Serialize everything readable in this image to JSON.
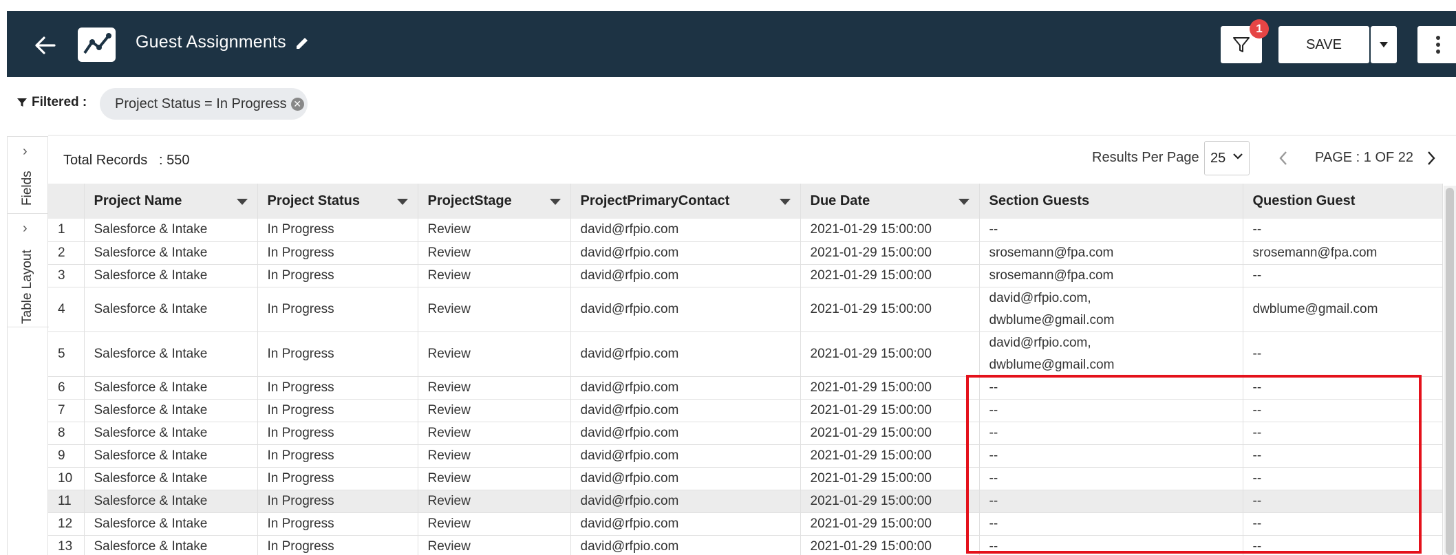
{
  "header": {
    "title": "Guest Assignments",
    "filter_badge": "1",
    "save_label": "SAVE"
  },
  "filter_bar": {
    "label": "Filtered :",
    "chip": "Project Status  = In Progress"
  },
  "side_panel": {
    "tabs": [
      "Fields",
      "Table Layout"
    ]
  },
  "grid_toolbar": {
    "total_records_label": "Total Records",
    "total_records_value": ": 550",
    "results_per_page_label": "Results Per Page",
    "results_per_page_value": "25",
    "page_info": "PAGE : 1 OF 22"
  },
  "table": {
    "columns": [
      "Project Name",
      "Project Status",
      "ProjectStage",
      "ProjectPrimaryContact",
      "Due Date",
      "Section Guests",
      "Question Guest"
    ],
    "rows": [
      {
        "n": "1",
        "name": "Salesforce & Intake",
        "status": "In Progress",
        "stage": "Review",
        "contact": "david@rfpio.com",
        "due": "2021-01-29 15:00:00",
        "section_guests": "--",
        "question_guest": "--"
      },
      {
        "n": "2",
        "name": "Salesforce & Intake",
        "status": "In Progress",
        "stage": "Review",
        "contact": "david@rfpio.com",
        "due": "2021-01-29 15:00:00",
        "section_guests": "srosemann@fpa.com",
        "question_guest": "srosemann@fpa.com"
      },
      {
        "n": "3",
        "name": "Salesforce & Intake",
        "status": "In Progress",
        "stage": "Review",
        "contact": "david@rfpio.com",
        "due": "2021-01-29 15:00:00",
        "section_guests": "srosemann@fpa.com",
        "question_guest": "--"
      },
      {
        "n": "4",
        "name": "Salesforce & Intake",
        "status": "In Progress",
        "stage": "Review",
        "contact": "david@rfpio.com",
        "due": "2021-01-29 15:00:00",
        "section_guests_1": "david@rfpio.com,",
        "section_guests_2": "dwblume@gmail.com",
        "question_guest": "dwblume@gmail.com"
      },
      {
        "n": "5",
        "name": "Salesforce & Intake",
        "status": "In Progress",
        "stage": "Review",
        "contact": "david@rfpio.com",
        "due": "2021-01-29 15:00:00",
        "section_guests_1": "david@rfpio.com,",
        "section_guests_2": "dwblume@gmail.com",
        "question_guest": "--"
      },
      {
        "n": "6",
        "name": "Salesforce & Intake",
        "status": "In Progress",
        "stage": "Review",
        "contact": "david@rfpio.com",
        "due": "2021-01-29 15:00:00",
        "section_guests": "--",
        "question_guest": "--"
      },
      {
        "n": "7",
        "name": "Salesforce & Intake",
        "status": "In Progress",
        "stage": "Review",
        "contact": "david@rfpio.com",
        "due": "2021-01-29 15:00:00",
        "section_guests": "--",
        "question_guest": "--"
      },
      {
        "n": "8",
        "name": "Salesforce & Intake",
        "status": "In Progress",
        "stage": "Review",
        "contact": "david@rfpio.com",
        "due": "2021-01-29 15:00:00",
        "section_guests": "--",
        "question_guest": "--"
      },
      {
        "n": "9",
        "name": "Salesforce & Intake",
        "status": "In Progress",
        "stage": "Review",
        "contact": "david@rfpio.com",
        "due": "2021-01-29 15:00:00",
        "section_guests": "--",
        "question_guest": "--"
      },
      {
        "n": "10",
        "name": "Salesforce & Intake",
        "status": "In Progress",
        "stage": "Review",
        "contact": "david@rfpio.com",
        "due": "2021-01-29 15:00:00",
        "section_guests": "--",
        "question_guest": "--"
      },
      {
        "n": "11",
        "name": "Salesforce & Intake",
        "status": "In Progress",
        "stage": "Review",
        "contact": "david@rfpio.com",
        "due": "2021-01-29 15:00:00",
        "section_guests": "--",
        "question_guest": "--"
      },
      {
        "n": "12",
        "name": "Salesforce & Intake",
        "status": "In Progress",
        "stage": "Review",
        "contact": "david@rfpio.com",
        "due": "2021-01-29 15:00:00",
        "section_guests": "--",
        "question_guest": "--"
      },
      {
        "n": "13",
        "name": "Salesforce & Intake",
        "status": "In Progress",
        "stage": "Review",
        "contact": "david@rfpio.com",
        "due": "2021-01-29 15:00:00",
        "section_guests": "--",
        "question_guest": "--"
      }
    ]
  },
  "colors": {
    "header_bg": "#1d3344",
    "badge": "#e64545",
    "highlight_box": "#e4111b"
  },
  "icons": [
    "back-arrow-icon",
    "app-logo-icon",
    "pencil-icon",
    "funnel-icon",
    "caret-down-icon",
    "kebab-menu-icon",
    "close-circle-icon",
    "chevron-right-icon",
    "chevron-left-icon"
  ]
}
